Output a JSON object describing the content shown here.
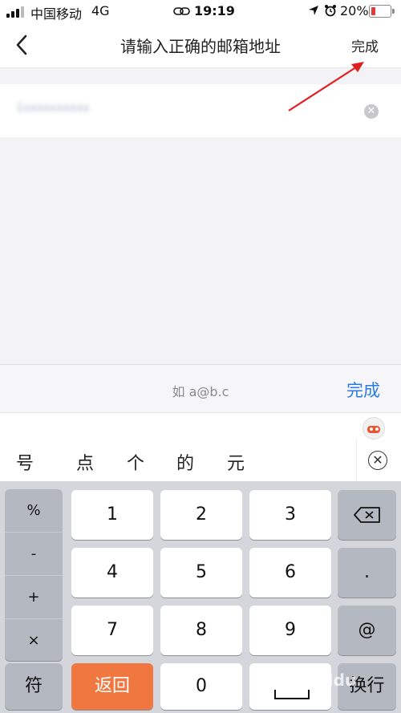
{
  "status_bar": {
    "carrier": "中国移动",
    "network": "4G",
    "time": "19:19",
    "battery": "20%"
  },
  "nav": {
    "title": "请输入正确的邮箱地址",
    "done": "完成"
  },
  "input": {
    "value": "1xxxxxxxxxx"
  },
  "keyboard_toolbar": {
    "hint": "如 a@b.c",
    "done": "完成"
  },
  "candidates": [
    "号",
    "点",
    "个",
    "的",
    "元"
  ],
  "keyboard": {
    "symbols": [
      "%",
      "-",
      "+",
      "×"
    ],
    "digits": [
      "1",
      "2",
      "3",
      "4",
      "5",
      "6",
      "7",
      "8",
      "9"
    ],
    "dot": ".",
    "at": "@",
    "symbol_key": "符",
    "return_key": "返回",
    "zero": "0",
    "newline_key": "换行"
  },
  "watermark": "Baidu",
  "colors": {
    "accent": "#2a7ae2",
    "return_key": "#f07840",
    "annotation_arrow": "#e02020"
  }
}
